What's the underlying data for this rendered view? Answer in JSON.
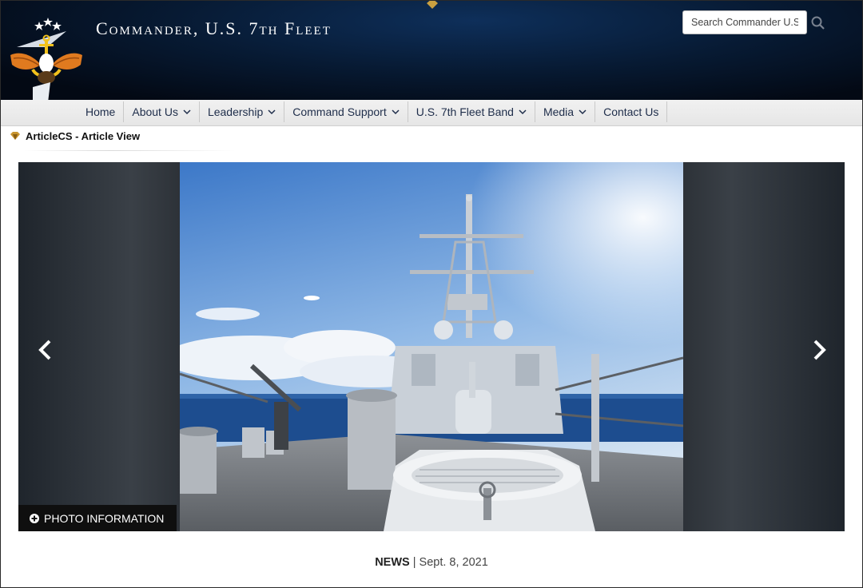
{
  "header": {
    "site_title": "Commander, U.S. 7th Fleet",
    "search": {
      "placeholder": "Search Commander U.S."
    },
    "icons": {
      "logo": "fleet-eagle-logo",
      "search": "search-icon"
    }
  },
  "nav": {
    "items": [
      {
        "label": "Home",
        "has_dropdown": false
      },
      {
        "label": "About Us",
        "has_dropdown": true
      },
      {
        "label": "Leadership",
        "has_dropdown": true
      },
      {
        "label": "Command Support",
        "has_dropdown": true
      },
      {
        "label": "U.S. 7th Fleet Band",
        "has_dropdown": true
      },
      {
        "label": "Media",
        "has_dropdown": true
      },
      {
        "label": "Contact Us",
        "has_dropdown": false
      }
    ]
  },
  "breadcrumb": {
    "label": "ArticleCS - Article View"
  },
  "carousel": {
    "photo_info_label": "PHOTO INFORMATION",
    "icons": {
      "prev": "chevron-left-icon",
      "next": "chevron-right-icon",
      "info": "plus-circle-icon"
    }
  },
  "article": {
    "category": "NEWS",
    "separator": "|",
    "date": "Sept. 8, 2021"
  },
  "colors": {
    "header_bg": "#071a33",
    "nav_text": "#1e2d4a",
    "accent_gold": "#caa040"
  }
}
